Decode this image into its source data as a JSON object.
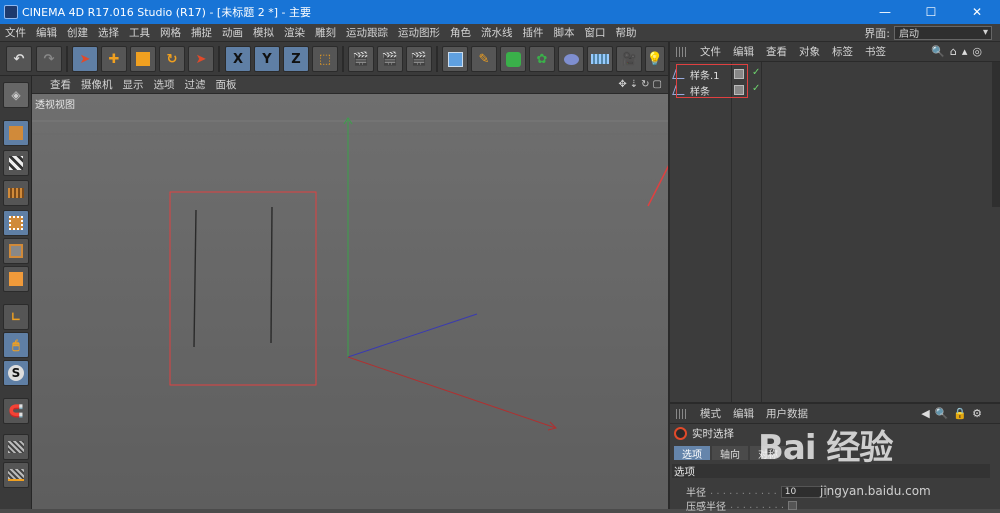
{
  "window": {
    "title": "CINEMA 4D R17.016 Studio (R17) - [未标题 2 *] - 主要",
    "minimize": "—",
    "maximize": "☐",
    "close": "✕"
  },
  "menubar": {
    "items": [
      "文件",
      "编辑",
      "创建",
      "选择",
      "工具",
      "网格",
      "捕捉",
      "动画",
      "模拟",
      "渲染",
      "雕刻",
      "运动跟踪",
      "运动图形",
      "角色",
      "流水线",
      "插件",
      "脚本",
      "窗口",
      "帮助"
    ],
    "layout_label": "界面:",
    "layout_value": "启动"
  },
  "toolbar": {
    "undo": "↶",
    "redo": "↷",
    "axis_x": "X",
    "axis_y": "Y",
    "axis_z": "Z"
  },
  "viewport": {
    "menu": [
      "查看",
      "摄像机",
      "显示",
      "选项",
      "过滤",
      "面板"
    ],
    "label": "透视视图"
  },
  "object_manager": {
    "menu": [
      "文件",
      "编辑",
      "查看",
      "对象",
      "标签",
      "书签"
    ],
    "objects": [
      {
        "name": "样条.1"
      },
      {
        "name": "样条"
      }
    ]
  },
  "attribute_manager": {
    "menu": [
      "模式",
      "编辑",
      "用户数据"
    ],
    "tool_name": "实时选择",
    "tabs": [
      "选项",
      "轴向",
      "对称"
    ],
    "section": "选项",
    "radius_label": "半径",
    "radius_value": "10",
    "pressure_label": "压感半径"
  },
  "watermark": {
    "brand": "Bai 经验",
    "url": "jingyan.baidu.com"
  },
  "colors": {
    "titlebar": "#1874d6",
    "highlight_red": "#e04040",
    "axis_y": "#3aa14a",
    "axis_x": "#b03030",
    "axis_z": "#3a3ab0"
  }
}
